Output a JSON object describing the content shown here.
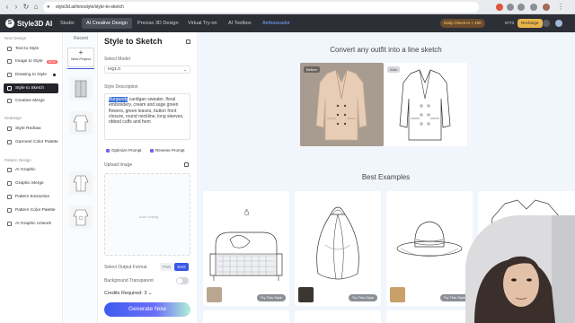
{
  "browser": {
    "url": "style3d.ai/innostyle/style-to-sketch"
  },
  "topnav": {
    "logo_text": "Style3D AI",
    "tabs": [
      {
        "label": "Studio"
      },
      {
        "label": "AI Creative Design"
      },
      {
        "label": "Precise 3D Design"
      },
      {
        "label": "Virtual Try-on"
      },
      {
        "label": "AI Toolbox"
      },
      {
        "label": "Ambassador"
      }
    ],
    "checkin": "Daily Check-in + 100",
    "credits": "9773",
    "recharge": "Recharge"
  },
  "sidebar": {
    "sections": [
      {
        "title": "New Design",
        "items": [
          {
            "label": "Text to Style"
          },
          {
            "label": "Image to Style",
            "badge": "NEW"
          },
          {
            "label": "Drawing to Style"
          },
          {
            "label": "Style to Sketch"
          },
          {
            "label": "Creative Merge"
          }
        ]
      },
      {
        "title": "Redesign",
        "items": [
          {
            "label": "Style Redraw"
          },
          {
            "label": "Garment Color Palette"
          }
        ]
      },
      {
        "title": "Pattern Design",
        "items": [
          {
            "label": "AI Graphic"
          },
          {
            "label": "Graphic Merge"
          },
          {
            "label": "Pattern Extraction"
          },
          {
            "label": "Pattern Color Palette"
          },
          {
            "label": "AI Graphic Artwork"
          }
        ]
      }
    ]
  },
  "recent": {
    "title": "Recent",
    "new_project": "New Project"
  },
  "panel": {
    "title": "Style to Sketch",
    "model_label": "Select Model",
    "model_value": "HQ1.0",
    "desc_label": "Style Description",
    "desc_selected": "Burgundy",
    "desc_rest": " cardigan sweater, floral embroidery, cream and sage green flowers, green leaves, button front closure, round neckline, long sleeves, ribbed cuffs and hem",
    "optimize": "Optimize Prompt",
    "reverse": "Reverse Prompt",
    "upload_label": "Upload Image",
    "upload_hint": "Auto cutting",
    "format_label": "Select Output Format",
    "format_png": "PNG",
    "format_svg": "SVG",
    "bg_label": "Background Transparent",
    "credits_required": "Credits Required:  3",
    "generate": "Generate Now"
  },
  "main": {
    "headline": "Convert any outfit into a line sketch",
    "before": "Before",
    "after": "After",
    "best_examples": "Best Examples",
    "try_label": "Try This Style"
  },
  "colors": {
    "accent": "#3b57e6",
    "nav_bg": "#2c2f36",
    "canvas_bg": "#f1f5fc"
  }
}
